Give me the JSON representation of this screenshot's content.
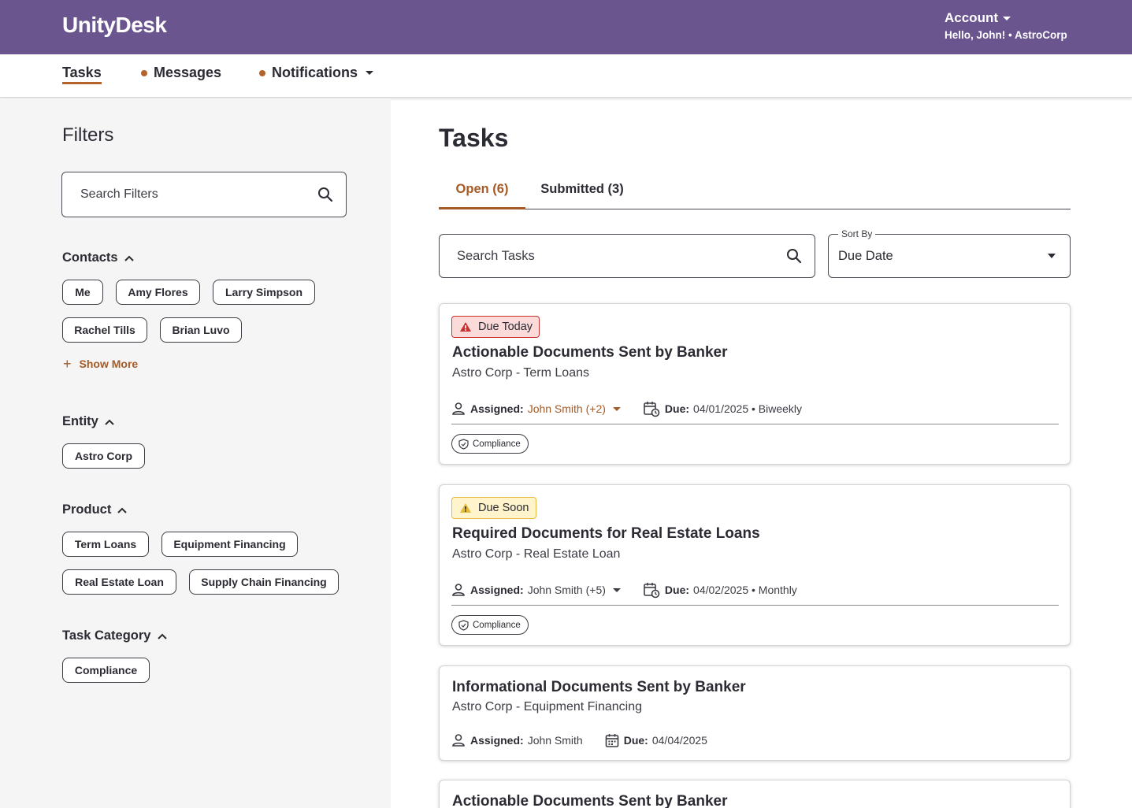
{
  "header": {
    "logo": "UnityDesk",
    "account_label": "Account",
    "greeting": "Hello, John! • AstroCorp"
  },
  "nav": {
    "tasks": "Tasks",
    "messages": "Messages",
    "notifications": "Notifications"
  },
  "sidebar": {
    "title": "Filters",
    "search_placeholder": "Search Filters",
    "contacts": {
      "heading": "Contacts",
      "chips": [
        "Me",
        "Amy Flores",
        "Larry Simpson",
        "Rachel Tills",
        "Brian Luvo"
      ],
      "show_more": "Show More"
    },
    "entity": {
      "heading": "Entity",
      "chips": [
        "Astro Corp"
      ]
    },
    "product": {
      "heading": "Product",
      "chips": [
        "Term Loans",
        "Equipment Financing",
        "Real Estate Loan",
        "Supply Chain Financing"
      ]
    },
    "task_category": {
      "heading": "Task Category",
      "chips": [
        "Compliance"
      ]
    }
  },
  "main": {
    "title": "Tasks",
    "tabs": [
      {
        "label": "Open (6)",
        "active": true
      },
      {
        "label": "Submitted (3)",
        "active": false
      }
    ],
    "search_placeholder": "Search Tasks",
    "sort": {
      "label": "Sort By",
      "value": "Due Date"
    },
    "tasks": [
      {
        "badge": "Due Today",
        "title": "Actionable Documents Sent by Banker",
        "subtitle": "Astro Corp - Term Loans",
        "assigned_label": "Assigned:",
        "assignee": "John Smith (+2)",
        "due_label": "Due:",
        "due": "04/01/2025 • Biweekly",
        "tag": "Compliance"
      },
      {
        "badge": "Due Soon",
        "title": "Required Documents for Real Estate Loans",
        "subtitle": "Astro Corp - Real Estate Loan",
        "assigned_label": "Assigned:",
        "assignee": "John Smith (+5)",
        "due_label": "Due:",
        "due": "04/02/2025 • Monthly",
        "tag": "Compliance"
      },
      {
        "title": "Informational Documents Sent by Banker",
        "subtitle": "Astro Corp - Equipment Financing",
        "assigned_label": "Assigned:",
        "assignee": "John Smith",
        "due_label": "Due:",
        "due": "04/04/2025"
      },
      {
        "title": "Actionable Documents Sent by Banker"
      }
    ]
  },
  "colors": {
    "header_bg": "#6a558f",
    "accent": "#a55a26",
    "danger": "#c8302f",
    "warning": "#e5b93a"
  }
}
